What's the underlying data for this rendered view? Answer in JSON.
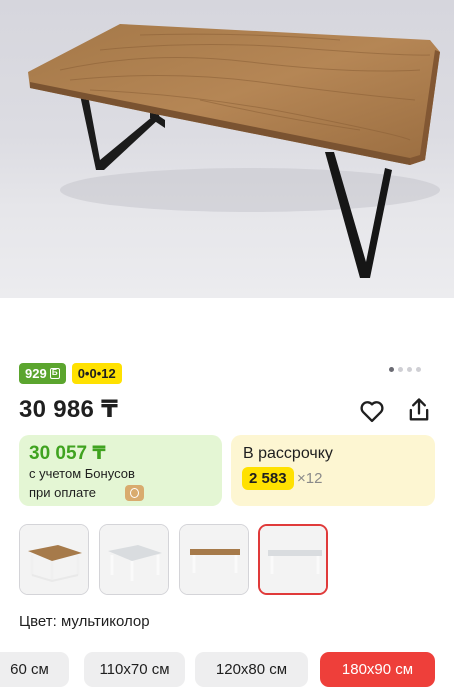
{
  "product": {
    "price": "30 986 ₸",
    "badges": {
      "bonus_value": "929",
      "bonus_currency": "Б",
      "installment_tag": "0•0•12"
    },
    "gallery_dots": 4,
    "gallery_active_index": 0
  },
  "bonus_card": {
    "price": "30 057 ₸",
    "line1": "с учетом Бонусов",
    "line2": "при оплате"
  },
  "installment_card": {
    "title": "В рассрочку",
    "amount": "2 583",
    "multiplier": "×12"
  },
  "variants": {
    "selected_index": 3
  },
  "color": {
    "label": "Цвет: мультиколор"
  },
  "sizes": {
    "items": [
      "60 см",
      "110x70 см",
      "120x80 см",
      "180x90 см"
    ],
    "selected_index": 3
  },
  "icons": {
    "favorite": "heart-icon",
    "share": "share-icon"
  },
  "colors": {
    "accent_red": "#ee3f3a",
    "bonus_green": "#40a320",
    "badge_yellow": "#ffe100"
  }
}
